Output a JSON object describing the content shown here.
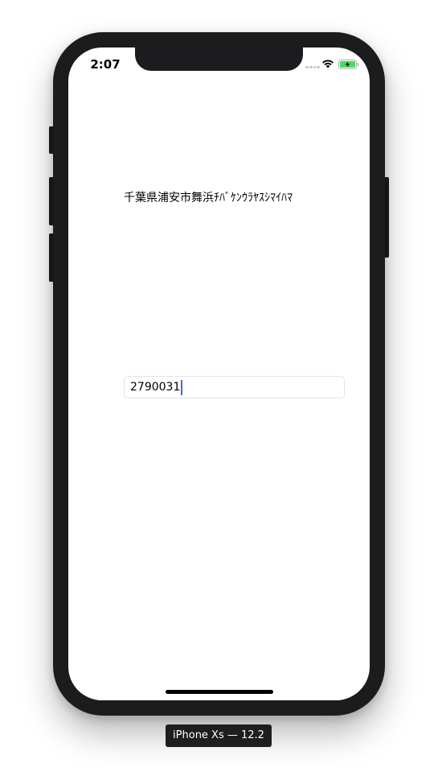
{
  "status_bar": {
    "time": "2:07"
  },
  "address": {
    "text": "千葉県浦安市舞浜ﾁﾊﾞｹﾝｳﾗﾔｽｼﾏｲﾊﾏ"
  },
  "zip_input": {
    "value": "2790031"
  },
  "simulator": {
    "device_label": "iPhone Xs — 12.2"
  },
  "colors": {
    "caret": "#3a6bd6",
    "battery_fill": "#4cd964",
    "phone_body": "#1c1c1e"
  },
  "icons": [
    "signal-dots-icon",
    "wifi-icon",
    "battery-charging-icon"
  ]
}
